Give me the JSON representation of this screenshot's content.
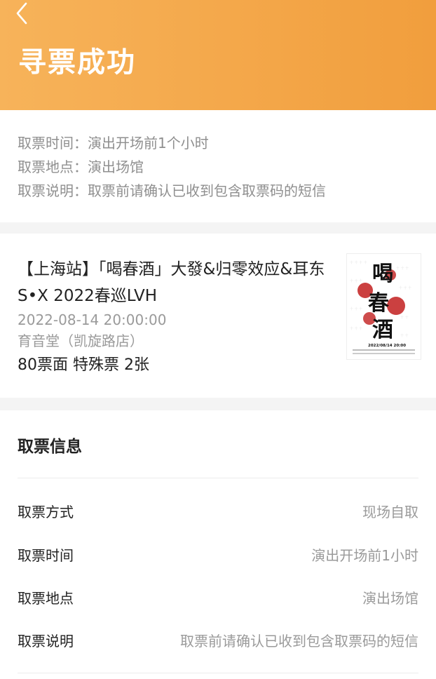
{
  "header": {
    "back_icon": "chevron-left-icon",
    "title": "寻票成功",
    "gradient": [
      "#f7b35a",
      "#f19e3d"
    ]
  },
  "notice": {
    "rows": [
      {
        "label": "取票时间：",
        "value": "演出开场前1个小时"
      },
      {
        "label": "取票地点：",
        "value": "演出场馆"
      },
      {
        "label": "取票说明：",
        "value": "取票前请确认已收到包含取票码的短信"
      }
    ]
  },
  "event": {
    "title": "【上海站】「喝春酒」大發&归零效应&耳东S•X 2022春巡LVH",
    "datetime": "2022-08-14 20:00:00",
    "venue": "育音堂（凯旋路店）",
    "ticket": "80票面 特殊票 2张",
    "poster": {
      "main_text": "喝春酒",
      "date_text": "2022/08/14 20:00",
      "accent": "#c21f1f"
    }
  },
  "pickup": {
    "heading": "取票信息",
    "rows": [
      {
        "key": "取票方式",
        "value": "现场自取"
      },
      {
        "key": "取票时间",
        "value": "演出开场前1小时"
      },
      {
        "key": "取票地点",
        "value": "演出场馆"
      },
      {
        "key": "取票说明",
        "value": "取票前请确认已收到包含取票码的短信"
      }
    ]
  }
}
